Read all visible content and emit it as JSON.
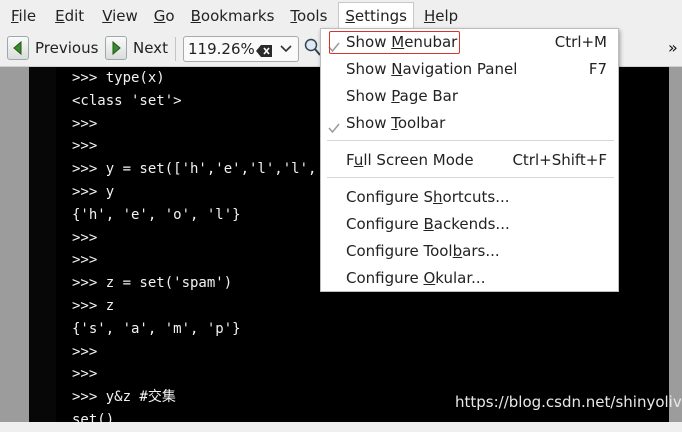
{
  "menubar": {
    "items": [
      {
        "pre": "",
        "acc": "F",
        "post": "ile"
      },
      {
        "pre": "",
        "acc": "E",
        "post": "dit"
      },
      {
        "pre": "",
        "acc": "V",
        "post": "iew"
      },
      {
        "pre": "",
        "acc": "G",
        "post": "o"
      },
      {
        "pre": "",
        "acc": "B",
        "post": "ookmarks"
      },
      {
        "pre": "",
        "acc": "T",
        "post": "ools"
      },
      {
        "pre": "",
        "acc": "S",
        "post": "ettings"
      },
      {
        "pre": "",
        "acc": "H",
        "post": "elp"
      }
    ]
  },
  "toolbar": {
    "previous_label": "Previous",
    "next_label": "Next",
    "zoom_value": "119.26%",
    "overflow_label": "»"
  },
  "settings_menu": {
    "items": [
      {
        "pre": "Show ",
        "acc": "M",
        "post": "enubar",
        "shortcut": "Ctrl+M",
        "checked": true
      },
      {
        "pre": "Show ",
        "acc": "N",
        "post": "avigation Panel",
        "shortcut": "F7",
        "checked": false
      },
      {
        "pre": "Show ",
        "acc": "P",
        "post": "age Bar",
        "shortcut": "",
        "checked": false
      },
      {
        "pre": "Show ",
        "acc": "T",
        "post": "oolbar",
        "shortcut": "",
        "checked": true
      },
      {
        "pre": "F",
        "acc": "u",
        "post": "ll Screen Mode",
        "shortcut": "Ctrl+Shift+F",
        "checked": false
      },
      {
        "pre": "Configure S",
        "acc": "h",
        "post": "ortcuts...",
        "shortcut": "",
        "checked": false
      },
      {
        "pre": "Configure ",
        "acc": "B",
        "post": "ackends...",
        "shortcut": "",
        "checked": false
      },
      {
        "pre": "Configure Tool",
        "acc": "b",
        "post": "ars...",
        "shortcut": "",
        "checked": false
      },
      {
        "pre": "Configure ",
        "acc": "O",
        "post": "kular...",
        "shortcut": "",
        "checked": false
      }
    ]
  },
  "document": {
    "code_lines": [
      ">>> type(x)",
      "<class 'set'>",
      ">>>",
      ">>>",
      ">>> y = set(['h','e','l','l',",
      ">>> y",
      "{'h', 'e', 'o', 'l'}",
      ">>>",
      ">>>",
      ">>> z = set('spam')",
      ">>> z",
      "{'s', 'a', 'm', 'p'}",
      ">>>",
      ">>>",
      ">>> y&z #交集",
      "set()"
    ],
    "watermark": "https://blog.csdn.net/shinyolive"
  },
  "colors": {
    "highlight_border": "#d9342b",
    "page_background": "#000000",
    "doc_background": "#9c9c9c"
  }
}
